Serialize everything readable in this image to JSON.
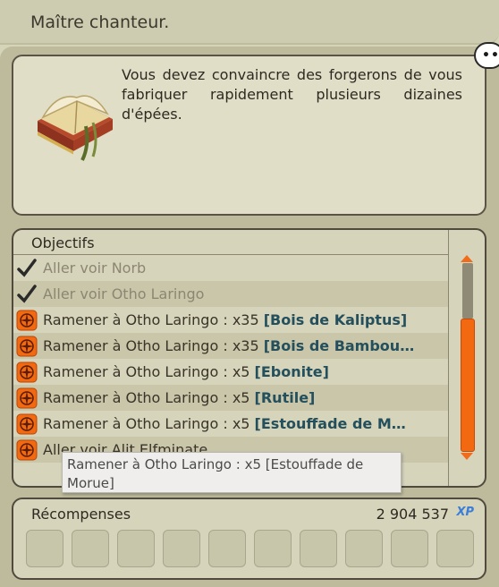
{
  "quest": {
    "title": "Maître chanteur.",
    "description": "Vous devez convaincre des forgerons de vous fabriquer rapidement plusieurs dizaines d'épées."
  },
  "objectives": {
    "header": "Objectifs",
    "items": [
      {
        "prefix": "Aller voir Norb",
        "item": "",
        "status": "done",
        "icon": "checkmark-icon"
      },
      {
        "prefix": "Aller voir Otho Laringo",
        "item": "",
        "status": "done",
        "icon": "checkmark-icon"
      },
      {
        "prefix": "Ramener à Otho Laringo : x35 ",
        "item": "[Bois de Kaliptus]",
        "status": "todo",
        "icon": "compass-icon"
      },
      {
        "prefix": "Ramener à Otho Laringo : x35 ",
        "item": "[Bois de Bambou…",
        "status": "todo",
        "icon": "compass-icon"
      },
      {
        "prefix": "Ramener à Otho Laringo : x5 ",
        "item": "[Ebonite]",
        "status": "todo",
        "icon": "compass-icon"
      },
      {
        "prefix": "Ramener à Otho Laringo : x5 ",
        "item": "[Rutile]",
        "status": "todo",
        "icon": "compass-icon"
      },
      {
        "prefix": "Ramener à Otho Laringo : x5 ",
        "item": "[Estouffade de M…",
        "status": "todo",
        "icon": "compass-icon"
      },
      {
        "prefix": "Aller voir Alit Elfminate",
        "item": "",
        "status": "todo",
        "icon": "compass-icon"
      }
    ],
    "tooltip": "Ramener à Otho Laringo : x5 [Estouffade de Morue]"
  },
  "rewards": {
    "header": "Récompenses",
    "xp_value": "2 904 537",
    "xp_label": "XP",
    "slot_count": 10
  },
  "colors": {
    "accent": "#f26912",
    "item_link": "#244f5c",
    "done_text": "#8c8672"
  }
}
